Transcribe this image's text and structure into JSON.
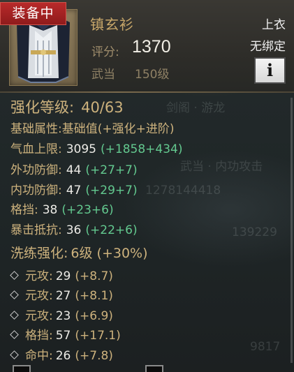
{
  "header": {
    "badge": "装备中",
    "name": "镇玄衫",
    "score_label": "评分:",
    "score_value": "1370",
    "school": "武当",
    "level": "150级",
    "slot": "上衣",
    "bind_status": "无绑定",
    "info_button": "i",
    "icon": "robe-icon"
  },
  "enhancement": {
    "label": "强化等级:",
    "value": "40/63"
  },
  "base_attr": {
    "label": "基础属性:",
    "value": "基础值(+强化+进阶)"
  },
  "stats": [
    {
      "label": "气血上限:",
      "value": "3095",
      "open": "(",
      "plus1": "+1858",
      "plus2": "+434",
      "close": ")"
    },
    {
      "label": "外功防御:",
      "value": "44",
      "open": "(",
      "plus1": "+27",
      "plus2": "+7",
      "close": ")"
    },
    {
      "label": "内功防御:",
      "value": "47",
      "open": "(",
      "plus1": "+29",
      "plus2": "+7",
      "close": ")"
    },
    {
      "label": "格挡:",
      "value": "38",
      "open": "(",
      "plus1": "+23",
      "plus2": "+6",
      "close": ")"
    },
    {
      "label": "暴击抵抗:",
      "value": "36",
      "open": "(",
      "plus1": "+22",
      "plus2": "+6",
      "close": ")"
    }
  ],
  "refine": {
    "label": "洗练强化:",
    "value": "6级 (+30%)"
  },
  "refine_items": [
    {
      "label": "元攻:",
      "value": "29",
      "bonus": "(+8.7)"
    },
    {
      "label": "元攻:",
      "value": "27",
      "bonus": "(+8.1)"
    },
    {
      "label": "元攻:",
      "value": "23",
      "bonus": "(+6.9)"
    },
    {
      "label": "格挡:",
      "value": "57",
      "bonus": "(+17.1)"
    },
    {
      "label": "命中:",
      "value": "26",
      "bonus": "(+7.8)"
    }
  ],
  "background_ghost": [
    "剑阁 · 游龙",
    "武当 · 内功攻击",
    "1278144418",
    "139229",
    "9817"
  ],
  "colors": {
    "gold_text": "#cdb27d",
    "green_bonus": "#63c98f",
    "badge_red": "#a82222"
  }
}
